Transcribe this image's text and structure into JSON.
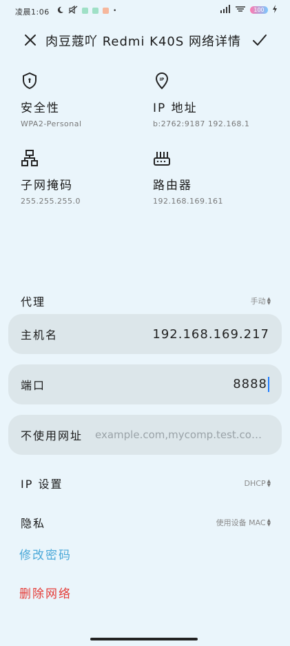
{
  "status_bar": {
    "time": "凌晨1:06",
    "battery": "100",
    "colors": {
      "dot1": "#9fe0c6",
      "dot2": "#9fe0c6",
      "dot3": "#f6b79c"
    }
  },
  "header": {
    "title": "肉豆蔻吖 Redmi K40S 网络详情",
    "close_icon": "close-icon",
    "confirm_icon": "checkmark-icon"
  },
  "info": {
    "security": {
      "label": "安全性",
      "value": "WPA2-Personal",
      "icon": "shield-icon"
    },
    "ip": {
      "label": "IP 地址",
      "value": "b:2762:9187 192.168.1",
      "icon": "ip-pin-icon"
    },
    "subnet": {
      "label": "子网掩码",
      "value": "255.255.255.0",
      "icon": "network-icon"
    },
    "router": {
      "label": "路由器",
      "value": "192.168.169.161",
      "icon": "router-icon"
    }
  },
  "proxy": {
    "label": "代理",
    "value": "手动",
    "hostname": {
      "label": "主机名",
      "value": "192.168.169.217"
    },
    "port": {
      "label": "端口",
      "value": "8888"
    },
    "bypass": {
      "label": "不使用网址",
      "placeholder": "example.com,mycomp.test.com,…"
    }
  },
  "ip_settings": {
    "label": "IP 设置",
    "value": "DHCP"
  },
  "privacy": {
    "label": "隐私",
    "value": "使用设备 MAC"
  },
  "actions": {
    "modify_password": "修改密码",
    "delete_network": "删除网络",
    "modify_color": "#4aa8d8",
    "delete_color": "#e53935"
  }
}
